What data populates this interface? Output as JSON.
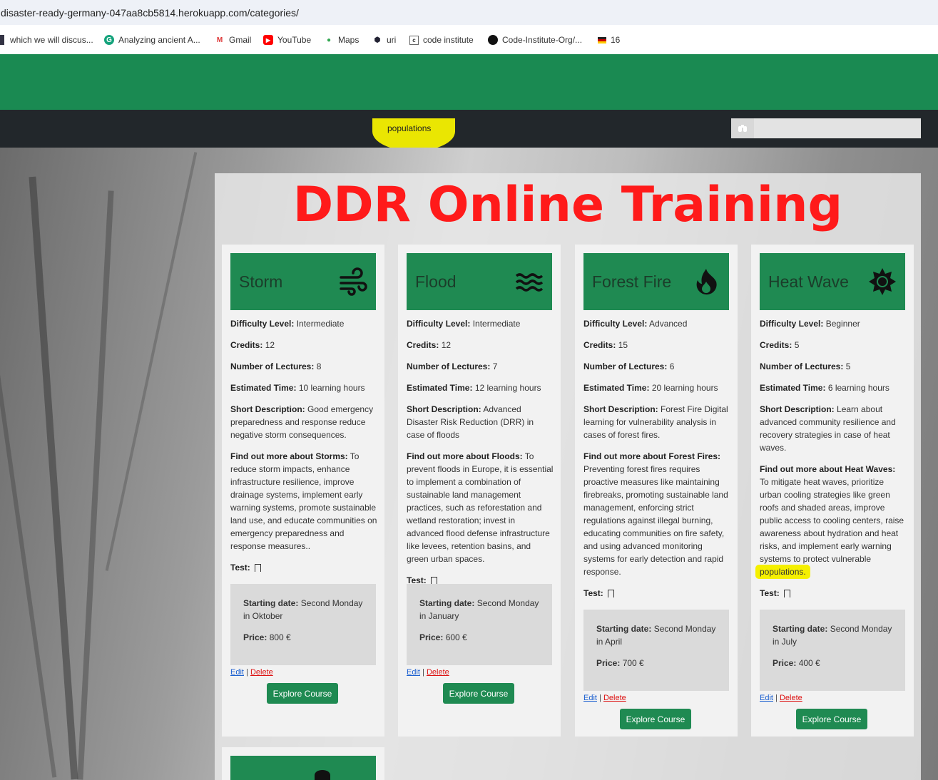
{
  "browser": {
    "url": "disaster-ready-germany-047aa8cb5814.herokuapp.com/categories/",
    "bookmarks": [
      {
        "label": "which we will discus...",
        "icon": "page-icon"
      },
      {
        "label": "Analyzing ancient A...",
        "icon": "grammarly-icon"
      },
      {
        "label": "Gmail",
        "icon": "gmail-icon"
      },
      {
        "label": "YouTube",
        "icon": "youtube-icon"
      },
      {
        "label": "Maps",
        "icon": "maps-pin-icon"
      },
      {
        "label": "uri",
        "icon": "hex-icon"
      },
      {
        "label": "code institute",
        "icon": "code-institute-icon"
      },
      {
        "label": "Code-Institute-Org/...",
        "icon": "github-icon"
      },
      {
        "label": "16",
        "icon": "flag-icon"
      }
    ]
  },
  "search": {
    "value": "populations"
  },
  "page": {
    "title": "DDR Online Training"
  },
  "labels": {
    "difficulty": "Difficulty Level:",
    "credits": "Credits:",
    "lectures": "Number of Lectures:",
    "time": "Estimated Time:",
    "short": "Short Description:",
    "test": "Test:",
    "start": "Starting date:",
    "price": "Price:",
    "edit": "Edit",
    "sep": "|",
    "delete": "Delete",
    "explore": "Explore Course"
  },
  "cards": [
    {
      "title": "Storm",
      "icon": "wind-icon",
      "difficulty": "Intermediate",
      "credits": "12",
      "lectures": "8",
      "time": "10 learning hours",
      "short": "Good emergency preparedness and response reduce negative storm consequences.",
      "more_label": "Find out more about Storms:",
      "more": "To reduce storm impacts, enhance infrastructure resilience, improve drainage systems, implement early warning systems, promote sustainable land use, and educate communities on emergency preparedness and response measures..",
      "start": "Second Monday in Oktober",
      "price": "800 €"
    },
    {
      "title": "Flood",
      "icon": "water-icon",
      "difficulty": "Intermediate",
      "credits": "12",
      "lectures": "7",
      "time": "12 learning hours",
      "short": "Advanced Disaster Risk Reduction (DRR) in case of floods",
      "more_label": "Find out more about Floods:",
      "more": "To prevent floods in Europe, it is essential to implement a combination of sustainable land management practices, such as reforestation and wetland restoration; invest in advanced flood defense infrastructure like levees, retention basins, and green urban spaces.",
      "start": "Second Monday in January",
      "price": "600 €"
    },
    {
      "title": "Forest Fire",
      "icon": "fire-icon",
      "difficulty": "Advanced",
      "credits": "15",
      "lectures": "6",
      "time": "20 learning hours",
      "short": "Forest Fire Digital learning for vulnerability analysis in cases of forest fires.",
      "more_label": "Find out more about Forest Fires:",
      "more": "Preventing forest fires requires proactive measures like maintaining firebreaks, promoting sustainable land management, enforcing strict regulations against illegal burning, educating communities on fire safety, and using advanced monitoring systems for early detection and rapid response.",
      "start": "Second Monday in April",
      "price": "700 €"
    },
    {
      "title": "Heat Wave",
      "icon": "sun-icon",
      "difficulty": "Beginner",
      "credits": "5",
      "lectures": "5",
      "time": "6 learning hours",
      "short": "Learn about advanced community resilience and recovery strategies in case of heat waves.",
      "more_label": "Find out more about Heat Waves:",
      "more": "To mitigate heat waves, prioritize urban cooling strategies like green roofs and shaded areas, improve public access to cooling centers, raise awareness about hydration and heat risks, and implement early warning systems to protect vulnerable",
      "more_highlight": "populations.",
      "start": "Second Monday in July",
      "price": "400 €"
    }
  ],
  "colors": {
    "brand_green": "#1a8a52",
    "title_red": "#ff1a1a",
    "highlight": "#f5f000"
  }
}
